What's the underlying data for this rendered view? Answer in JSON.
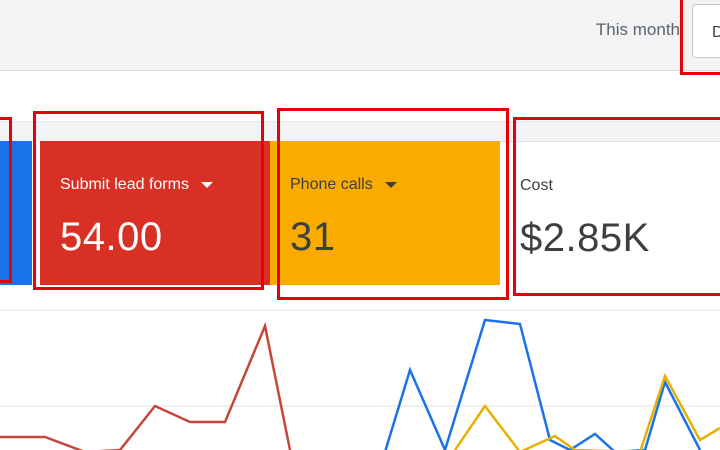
{
  "header": {
    "date_range_label": "This month",
    "date_button_label": "D"
  },
  "scorecards": [
    {
      "label": "Submit lead forms",
      "value": "54.00",
      "color": "#d93025"
    },
    {
      "label": "Phone calls",
      "value": "31",
      "color": "#f9ab00"
    },
    {
      "label": "Cost",
      "value": "$2.85K",
      "color": "#ffffff"
    }
  ],
  "series_colors": {
    "blue": "#1a73e8",
    "red": "#c5473a",
    "yellow": "#e8b000"
  },
  "highlight_color": "#e8000b"
}
